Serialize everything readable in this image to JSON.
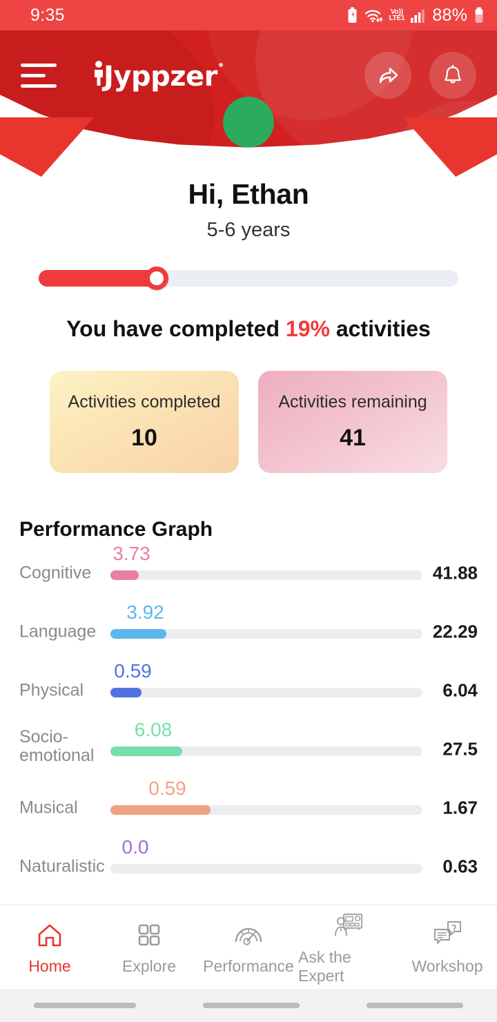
{
  "status_bar": {
    "time": "9:35",
    "network_label_top": "Vo))",
    "network_label_bottom": "LTE1",
    "battery_percent": "88%",
    "icons": [
      "battery-saver-icon",
      "wifi-icon",
      "volte-icon",
      "signal-bars-icon",
      "battery-icon"
    ]
  },
  "header": {
    "menu_icon": "hamburger-menu-icon",
    "logo_text": "Jyppzer",
    "share_icon": "share-icon",
    "notification_icon": "bell-icon",
    "background_color": "#d21f1f",
    "accent_color": "#e8352e"
  },
  "greeting": {
    "name": "Hi, Ethan",
    "age_range": "5-6 years"
  },
  "progress": {
    "percent": 19,
    "fill_color": "#ef3b3b",
    "track_color": "#eceef5",
    "message_prefix": "You have completed ",
    "message_percent": "19%",
    "message_suffix": " activities"
  },
  "stat_cards": [
    {
      "label": "Activities completed",
      "value": "10",
      "theme": "yellow"
    },
    {
      "label": "Activities remaining",
      "value": "41",
      "theme": "pink"
    }
  ],
  "performance": {
    "title": "Performance Graph"
  },
  "chart_data": {
    "type": "bar",
    "title": "Performance Graph",
    "xlabel": "",
    "ylabel": "",
    "orientation": "horizontal",
    "bar_track_color": "#ebedee",
    "categories": [
      "Cognitive",
      "Language",
      "Physical",
      "Socio-emotional",
      "Musical",
      "Naturalistic"
    ],
    "series": [
      {
        "name": "score",
        "values": [
          3.73,
          3.92,
          0.59,
          6.08,
          0.59,
          0.0
        ]
      },
      {
        "name": "total",
        "values": [
          41.88,
          22.29,
          6.04,
          27.5,
          1.67,
          0.63
        ]
      }
    ],
    "rows": [
      {
        "label": "Cognitive",
        "value": "3.73",
        "value_num": 3.73,
        "total": "41.88",
        "fill_pct": 9,
        "color": "#e8809f"
      },
      {
        "label": "Language",
        "value": "3.92",
        "value_num": 3.92,
        "total": "22.29",
        "fill_pct": 18,
        "color": "#5bb8ef"
      },
      {
        "label": "Physical",
        "value": "0.59",
        "value_num": 0.59,
        "total": "6.04",
        "fill_pct": 10,
        "color": "#5272e0"
      },
      {
        "label": "Socio-emotional",
        "value": "6.08",
        "value_num": 6.08,
        "total": "27.5",
        "fill_pct": 23,
        "color": "#74e0ab"
      },
      {
        "label": "Musical",
        "value": "0.59",
        "value_num": 0.59,
        "total": "1.67",
        "fill_pct": 32,
        "color": "#f0a183"
      },
      {
        "label": "Naturalistic",
        "value": "0.0",
        "value_num": 0.0,
        "total": "0.63",
        "fill_pct": 0,
        "color": "#9a6fd6"
      }
    ]
  },
  "bottom_nav": {
    "active_index": 0,
    "active_color": "#e8352e",
    "inactive_color": "#9a9a9a",
    "items": [
      {
        "label": "Home",
        "icon": "home-icon"
      },
      {
        "label": "Explore",
        "icon": "grid-icon"
      },
      {
        "label": "Performance",
        "icon": "speedometer-icon"
      },
      {
        "label": "Ask the Expert",
        "icon": "presenter-icon"
      },
      {
        "label": "Workshop",
        "icon": "chat-question-icon"
      }
    ]
  }
}
